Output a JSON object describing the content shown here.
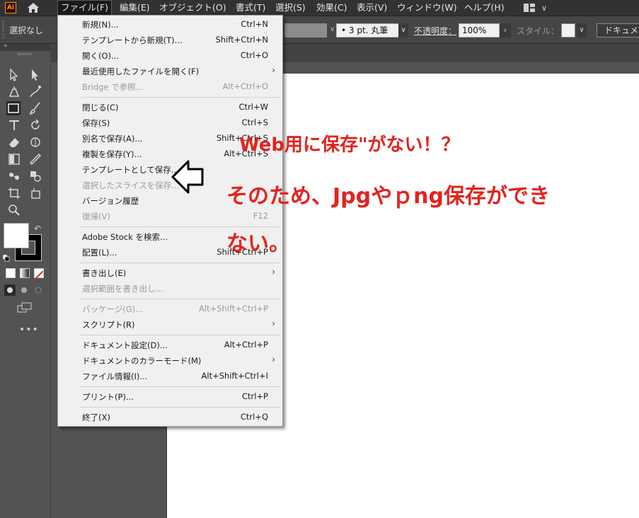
{
  "menubar": {
    "app_logo": "Ai",
    "items": [
      "ファイル(F)",
      "編集(E)",
      "オブジェクト(O)",
      "書式(T)",
      "選択(S)",
      "効果(C)",
      "表示(V)",
      "ウィンドウ(W)",
      "ヘルプ(H)"
    ]
  },
  "controlbar": {
    "selection_label": "選択なし",
    "stroke_profile": "3 pt. 丸筆",
    "opacity_label": "不透明度：",
    "opacity_value": "100%",
    "style_label": "スタイル：",
    "document_button": "ドキュメント"
  },
  "file_menu": {
    "groups": [
      [
        {
          "label": "新規(N)...",
          "shortcut": "Ctrl+N",
          "disabled": false
        },
        {
          "label": "テンプレートから新規(T)...",
          "shortcut": "Shift+Ctrl+N",
          "disabled": false
        },
        {
          "label": "開く(O)...",
          "shortcut": "Ctrl+O",
          "disabled": false
        },
        {
          "label": "最近使用したファイルを開く(F)",
          "shortcut": "",
          "submenu": true,
          "disabled": false
        },
        {
          "label": "Bridge で参照...",
          "shortcut": "Alt+Ctrl+O",
          "disabled": true
        }
      ],
      [
        {
          "label": "閉じる(C)",
          "shortcut": "Ctrl+W",
          "disabled": false
        },
        {
          "label": "保存(S)",
          "shortcut": "Ctrl+S",
          "disabled": false
        },
        {
          "label": "別名で保存(A)...",
          "shortcut": "Shift+Ctrl+S",
          "disabled": false
        },
        {
          "label": "複製を保存(Y)...",
          "shortcut": "Alt+Ctrl+S",
          "disabled": false
        },
        {
          "label": "テンプレートとして保存...",
          "shortcut": "",
          "disabled": false
        },
        {
          "label": "選択したスライスを保存...",
          "shortcut": "",
          "disabled": true
        },
        {
          "label": "バージョン履歴",
          "shortcut": "",
          "disabled": false
        },
        {
          "label": "復帰(V)",
          "shortcut": "F12",
          "disabled": true
        }
      ],
      [
        {
          "label": "Adobe Stock を検索...",
          "shortcut": "",
          "disabled": false
        },
        {
          "label": "配置(L)...",
          "shortcut": "Shift+Ctrl+P",
          "disabled": false
        }
      ],
      [
        {
          "label": "書き出し(E)",
          "shortcut": "",
          "submenu": true,
          "disabled": false
        },
        {
          "label": "選択範囲を書き出し...",
          "shortcut": "",
          "disabled": true
        }
      ],
      [
        {
          "label": "パッケージ(G)...",
          "shortcut": "Alt+Shift+Ctrl+P",
          "disabled": true
        },
        {
          "label": "スクリプト(R)",
          "shortcut": "",
          "submenu": true,
          "disabled": false
        }
      ],
      [
        {
          "label": "ドキュメント設定(D)...",
          "shortcut": "Alt+Ctrl+P",
          "disabled": false
        },
        {
          "label": "ドキュメントのカラーモード(M)",
          "shortcut": "",
          "submenu": true,
          "disabled": false
        },
        {
          "label": "ファイル情報(I)...",
          "shortcut": "Alt+Shift+Ctrl+I",
          "disabled": false
        }
      ],
      [
        {
          "label": "プリント(P)...",
          "shortcut": "Ctrl+P",
          "disabled": false
        }
      ],
      [
        {
          "label": "終了(X)",
          "shortcut": "Ctrl+Q",
          "disabled": false
        }
      ]
    ]
  },
  "annotation": {
    "line1": "Web用に保存\"がない！？",
    "line2": "そのため、Jpgやｐng保存ができ",
    "line3": "ない。",
    "color": "#e1241f"
  },
  "colors": {
    "menubar_bg": "#323232",
    "panel_bg": "#535353",
    "menu_bg": "#f0f0f0"
  }
}
